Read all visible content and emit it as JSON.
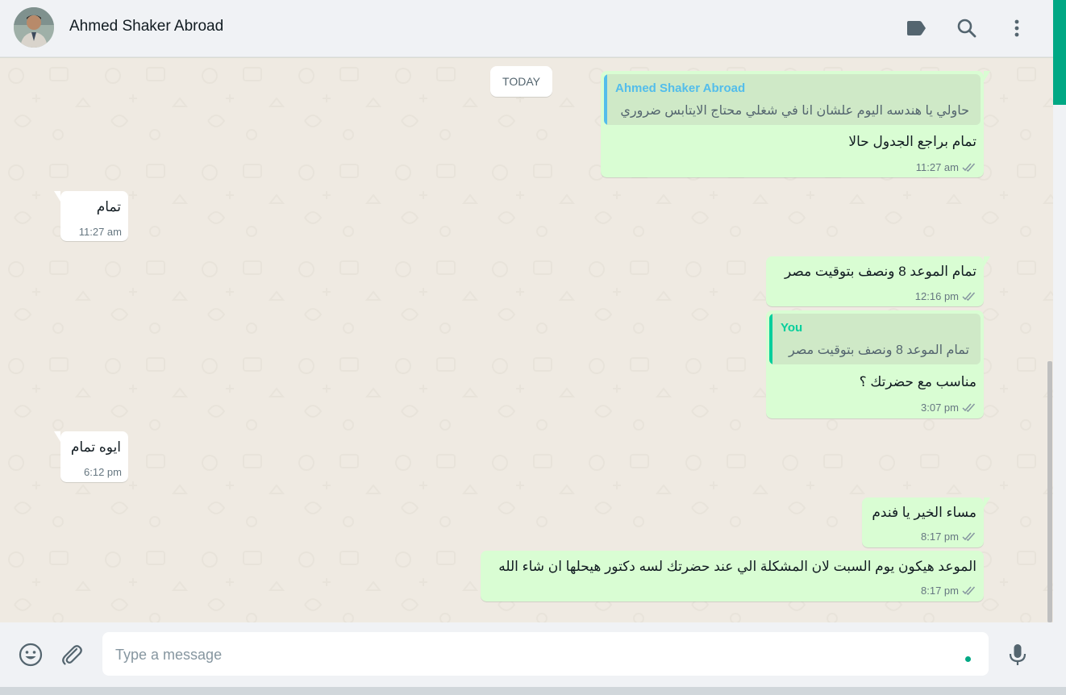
{
  "header": {
    "contact_name": "Ahmed Shaker Abroad",
    "icons": [
      "label-icon",
      "search-icon",
      "menu-icon"
    ]
  },
  "chat": {
    "day_chip": "TODAY",
    "messages": [
      {
        "direction": "outgoing",
        "quoted": {
          "author": "Ahmed Shaker Abroad",
          "text": "حاولي يا هندسه اليوم علشان انا في شغلي محتاج الايتابس ضروري",
          "author_color": "#53bdeb"
        },
        "text": "تمام براجع الجدول حالا",
        "time": "11:27 am",
        "status": "read"
      },
      {
        "direction": "incoming",
        "text": "تمام",
        "time": "11:27 am"
      },
      {
        "direction": "outgoing",
        "text": "تمام الموعد 8 ونصف بتوقيت مصر",
        "time": "12:16 pm",
        "status": "read"
      },
      {
        "direction": "outgoing",
        "quoted": {
          "author": "You",
          "text": "تمام الموعد 8 ونصف بتوقيت مصر",
          "author_color": "#06cf9c"
        },
        "text": "مناسب مع حضرتك ؟",
        "time": "3:07 pm",
        "status": "read"
      },
      {
        "direction": "incoming",
        "text": "ايوه تمام",
        "time": "6:12 pm"
      },
      {
        "direction": "outgoing",
        "text": "مساء الخير يا فندم",
        "time": "8:17 pm",
        "status": "read"
      },
      {
        "direction": "outgoing",
        "text": "الموعد هيكون يوم السبت لان المشكلة الي عند حضرتك لسه دكتور هيحلها ان شاء الله",
        "time": "8:17 pm",
        "status": "read"
      }
    ]
  },
  "composer": {
    "placeholder": "Type a message",
    "value": ""
  },
  "colors": {
    "accent": "#00a884",
    "outgoing_bubble": "#d9fdd3",
    "incoming_bubble": "#ffffff",
    "read_tick": "#8696a0"
  }
}
